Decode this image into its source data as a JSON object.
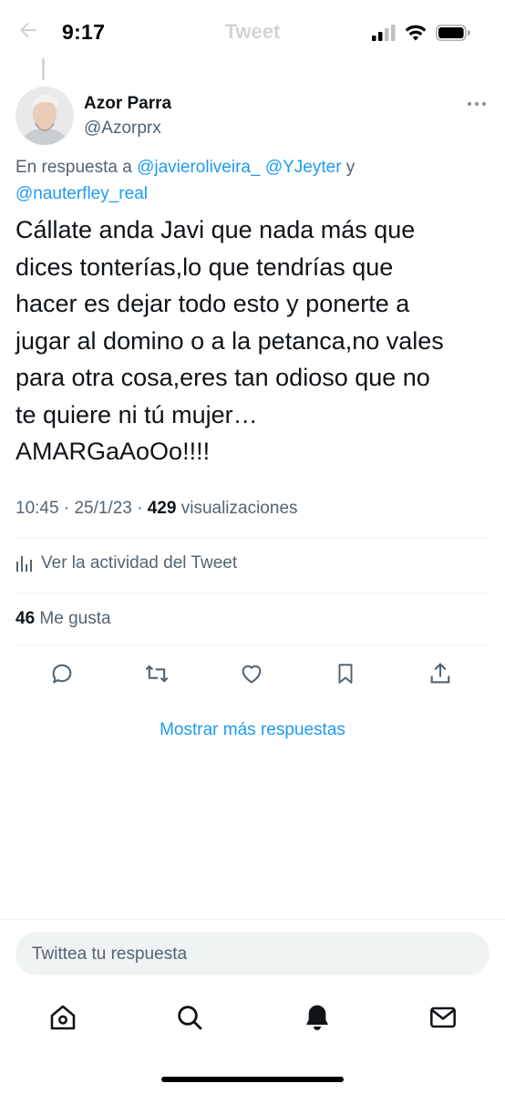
{
  "status_bar": {
    "time": "9:17"
  },
  "header": {
    "title": "Tweet"
  },
  "tweet": {
    "author_name": "Azor Parra",
    "author_handle": "@Azorprx",
    "reply_prefix": "En respuesta a ",
    "reply_mentions": [
      "@javieroliveira_",
      "@YJeyter",
      "@nauterfley_real"
    ],
    "reply_joiner": " y",
    "text": "Cállate anda Javi que nada más que\ndices tonterías,lo que tendrías que\nhacer es dejar todo esto y ponerte a\njugar al domino o a la petanca,no vales\npara otra cosa,eres tan odioso que no\nte quiere ni tú mujer…\nAMARGaAoOo!!!!",
    "time": "10:45",
    "date": "25/1/23",
    "views_count": "429",
    "views_label": "visualizaciones",
    "activity_label": "Ver la actividad del Tweet",
    "likes_count": "46",
    "likes_label": "Me gusta"
  },
  "actions": [
    "reply-icon",
    "retweet-icon",
    "like-icon",
    "bookmark-icon",
    "share-icon"
  ],
  "more_replies_label": "Mostrar más respuestas",
  "composer": {
    "placeholder": "Twittea tu respuesta"
  },
  "nav": [
    "home-icon",
    "search-icon",
    "notifications-icon",
    "messages-icon"
  ],
  "colors": {
    "accent": "#1d9bf0",
    "secondary_text": "#536471",
    "primary_text": "#0f1419"
  }
}
